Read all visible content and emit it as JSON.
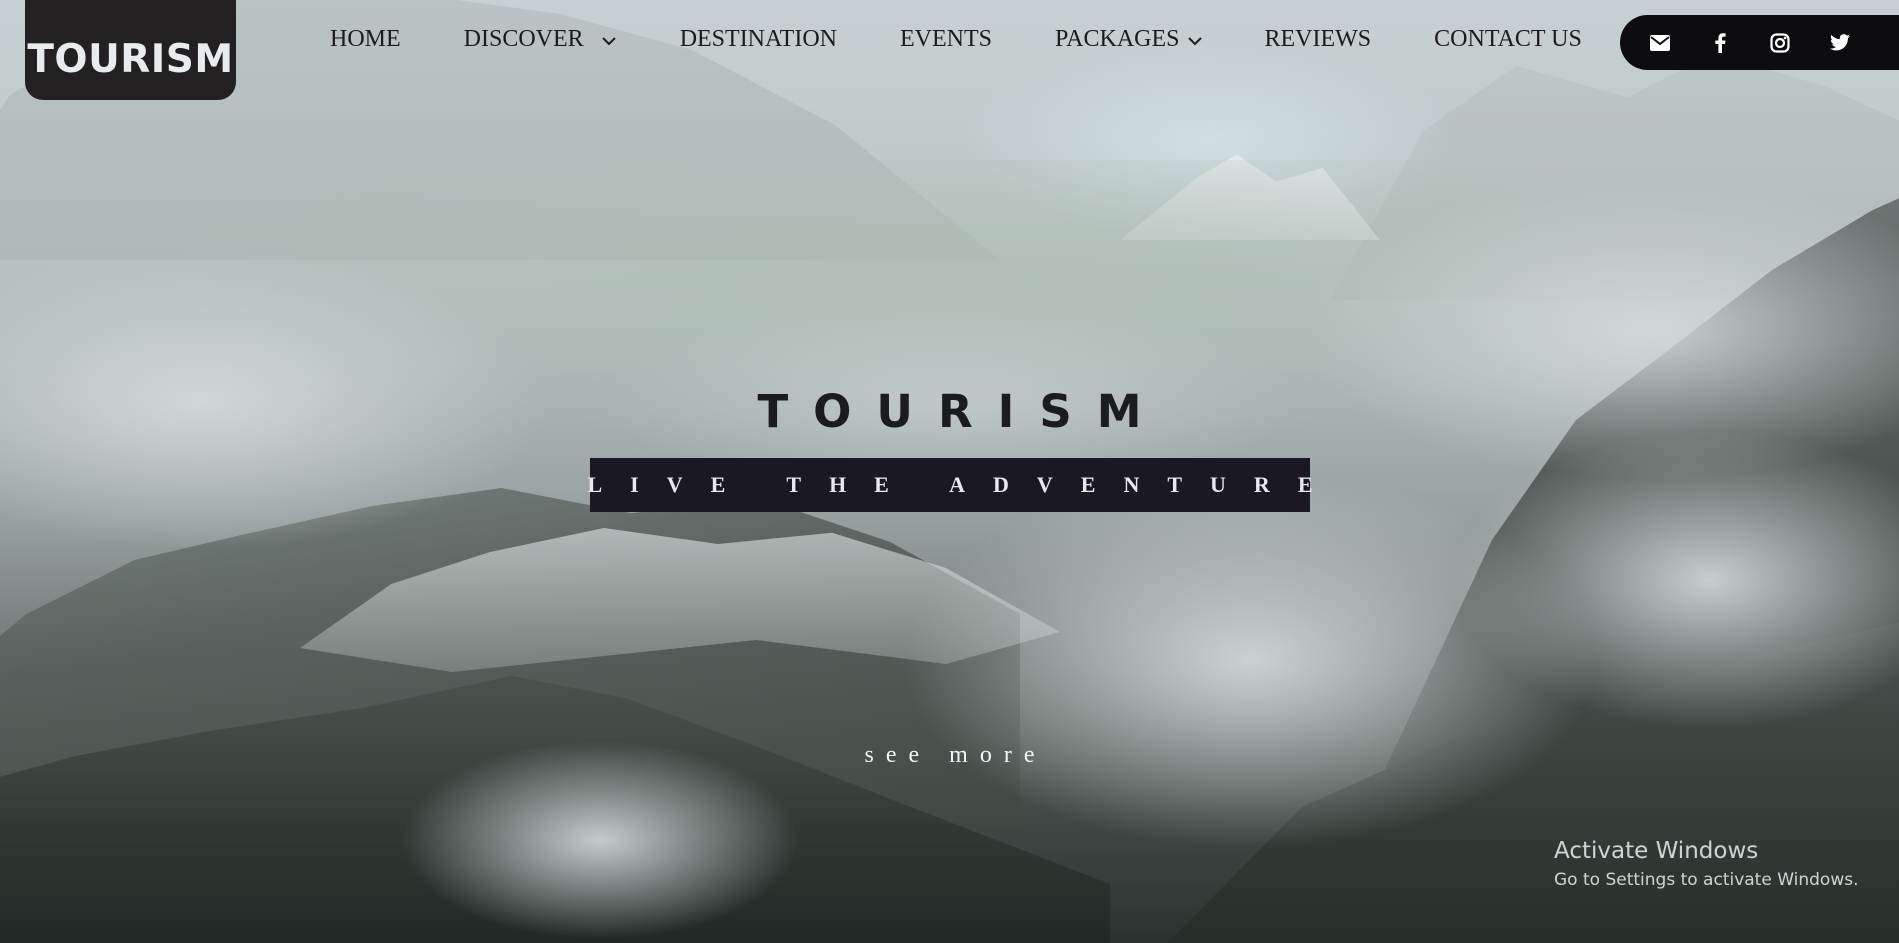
{
  "brand": {
    "logo_text": "TOURISM"
  },
  "nav": {
    "items": [
      {
        "label": "HOME",
        "has_dropdown": false
      },
      {
        "label": "DISCOVER",
        "has_dropdown": true
      },
      {
        "label": "DESTINATION",
        "has_dropdown": false
      },
      {
        "label": "EVENTS",
        "has_dropdown": false
      },
      {
        "label": "PACKAGES",
        "has_dropdown": true
      },
      {
        "label": "REVIEWS",
        "has_dropdown": false
      },
      {
        "label": "CONTACT US",
        "has_dropdown": false
      }
    ]
  },
  "social": {
    "icons": [
      "envelope-icon",
      "facebook-icon",
      "instagram-icon",
      "twitter-icon"
    ]
  },
  "hero": {
    "title": "TOURISM",
    "tagline": "LIVE THE ADVENTURE",
    "cta": "see more"
  },
  "system_overlay": {
    "line1": "Activate Windows",
    "line2": "Go to Settings to activate Windows."
  },
  "colors": {
    "logo_bg": "#222021",
    "tagline_bg": "#1a1820",
    "social_bg": "#0d0d0f",
    "nav_text": "#1c1c1e"
  }
}
